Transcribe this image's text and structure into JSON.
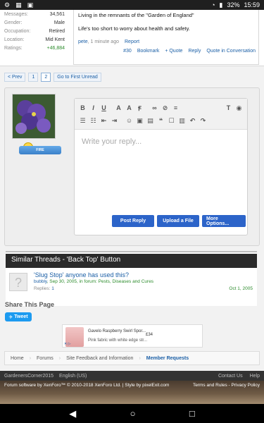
{
  "status_bar": {
    "battery": "32%",
    "time": "15:59"
  },
  "post": {
    "stats": [
      {
        "label": "Messages:",
        "value": "34,561"
      },
      {
        "label": "Gender:",
        "value": "Male"
      },
      {
        "label": "Occupation:",
        "value": "Retired"
      },
      {
        "label": "Location:",
        "value": "Mid Kent"
      },
      {
        "label": "Ratings:",
        "value": "+46,884"
      }
    ],
    "text1": "Living in the remnants of the \"Garden of England\"",
    "text2": "Life's too short to worry about health and safety.",
    "author": "pete",
    "time": ", 1 minute ago",
    "report": "Report",
    "number": "#30",
    "actions": [
      "Bookmark",
      "+ Quote",
      "Reply",
      "Quote in Conversation"
    ]
  },
  "pager": {
    "prev": "< Prev",
    "pages": [
      "1",
      "2"
    ],
    "first_unread": "Go to First Unread"
  },
  "reply": {
    "fire_label": "FIRE",
    "placeholder": "Write your reply...",
    "post_button": "Post Reply",
    "upload_button": "Upload a File",
    "more_button": "More Options..."
  },
  "similar": {
    "title": "Similar Threads - 'Back Top' Button",
    "thread_title": "'Slug Stop' anyone has used this?",
    "thread_user": "bubbly",
    "thread_meta": ", Sep 30, 2005, in forum: Pests, Diseases and Cures",
    "replies_label": "Replies:",
    "replies": "1",
    "date": "Oct 1, 2005"
  },
  "share": {
    "title": "Share This Page",
    "tweet": "Tweet"
  },
  "ad": {
    "title": "Gavelo Raspberry Swirl Spor...",
    "subtitle": "Pink fabric with white edge str...",
    "price": "£34"
  },
  "breadcrumb": [
    "Home",
    "Forums",
    "Site Feedback and Information",
    "Member Requests"
  ],
  "footer": {
    "site": "GardenersCorner2015",
    "language": "English (US)",
    "contact": "Contact Us",
    "help": "Help",
    "software": "Forum software by XenForo™ © 2010-2018 XenForo Ltd. | Style by pixelExit.com",
    "terms": "Terms and Rules",
    "privacy": "Privacy Policy"
  }
}
